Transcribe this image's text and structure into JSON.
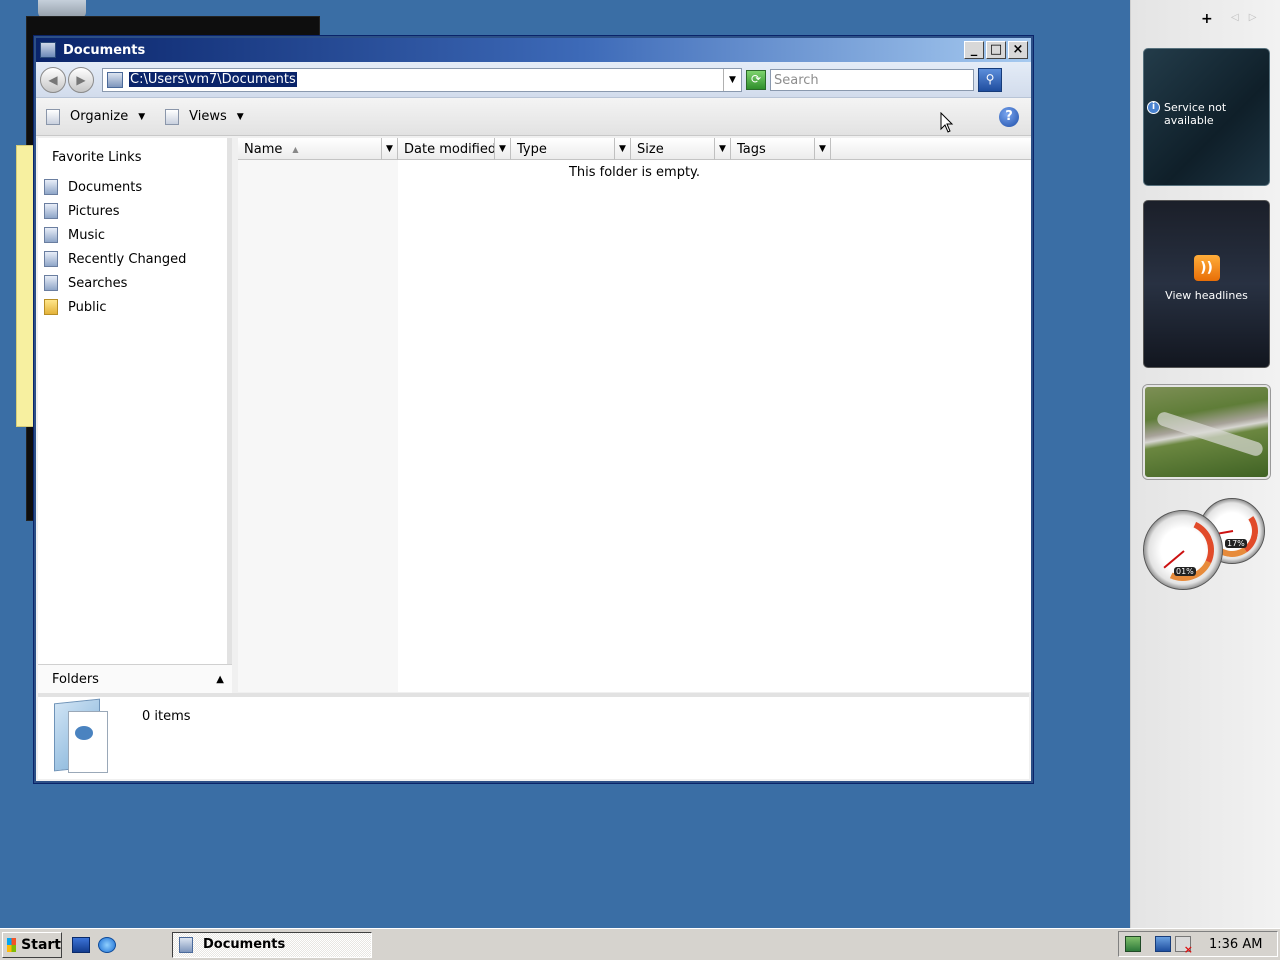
{
  "window": {
    "title": "Documents",
    "controls": [
      "_",
      "□",
      "×"
    ]
  },
  "address": {
    "path": "C:\\Users\\vm7\\Documents",
    "search_placeholder": "Search"
  },
  "toolbar": {
    "organize_label": "Organize",
    "views_label": "Views",
    "help_label": "?"
  },
  "nav": {
    "favorites_title": "Favorite Links",
    "items": [
      {
        "label": "Documents",
        "icon": "documents-icon"
      },
      {
        "label": "Pictures",
        "icon": "pictures-icon"
      },
      {
        "label": "Music",
        "icon": "music-icon"
      },
      {
        "label": "Recently Changed",
        "icon": "recently-changed-icon"
      },
      {
        "label": "Searches",
        "icon": "searches-icon"
      },
      {
        "label": "Public",
        "icon": "folder-icon"
      }
    ],
    "folders_label": "Folders"
  },
  "columns": [
    {
      "label": "Name",
      "sorted": "ascending"
    },
    {
      "label": "Date modified"
    },
    {
      "label": "Type"
    },
    {
      "label": "Size"
    },
    {
      "label": "Tags"
    }
  ],
  "file_list": {
    "empty_message": "This folder is empty."
  },
  "details": {
    "count": "0 items"
  },
  "sidebar": {
    "weather_message": "Service not available",
    "feed_label": "View headlines",
    "cpu_percent": "01%",
    "memory_percent": "17%"
  },
  "taskbar": {
    "start_label": "Start",
    "task_label": "Documents",
    "clock": "1:36 AM"
  },
  "colors": {
    "desktop": "#3a6ea5",
    "title_active": "#0a246a",
    "selection": "#0a246a"
  }
}
